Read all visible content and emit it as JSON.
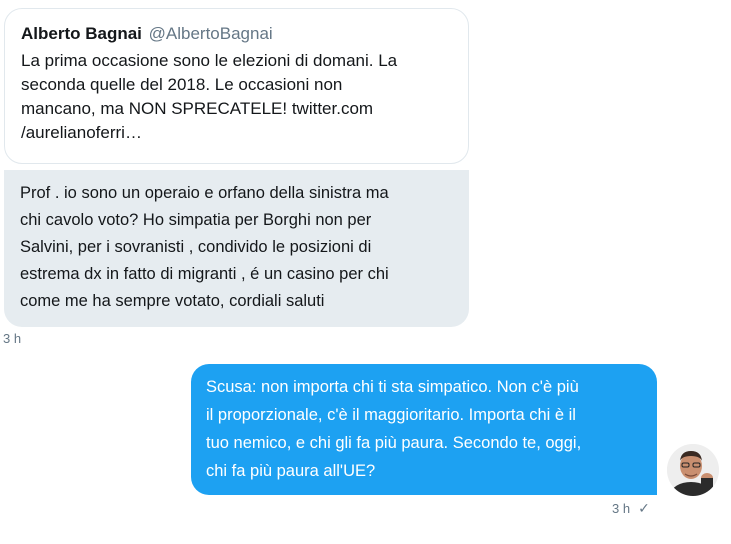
{
  "quoted_tweet": {
    "author_name": "Alberto Bagnai",
    "author_handle": "@AlbertoBagnai",
    "text": "La prima occasione sono le elezioni di domani. La\nseconda quelle del 2018. Le occasioni non\nmancano, ma NON SPRECATELE! twitter.com\n/aurelianoferri…"
  },
  "messages": [
    {
      "direction": "received",
      "text": "Prof . io sono un operaio e orfano della sinistra ma\nchi cavolo voto? Ho simpatia per Borghi non per\nSalvini, per i sovranisti , condivido le posizioni di\nestrema dx in fatto di migranti , é un casino per chi\ncome me ha sempre votato, cordiali saluti",
      "timestamp": "3 h"
    },
    {
      "direction": "sent",
      "text": "Scusa: non importa chi ti sta simpatico. Non c'è più\nil proporzionale, c'è il maggioritario. Importa chi è il\ntuo nemico, e chi gli fa più paura. Secondo te, oggi,\nchi fa più paura all'UE?",
      "timestamp": "3 h",
      "status_icon": "checkmark-icon",
      "status_glyph": "✓"
    }
  ],
  "colors": {
    "sent_bubble": "#1da1f2",
    "received_bubble": "#e6ecf0",
    "secondary_text": "#657786"
  }
}
